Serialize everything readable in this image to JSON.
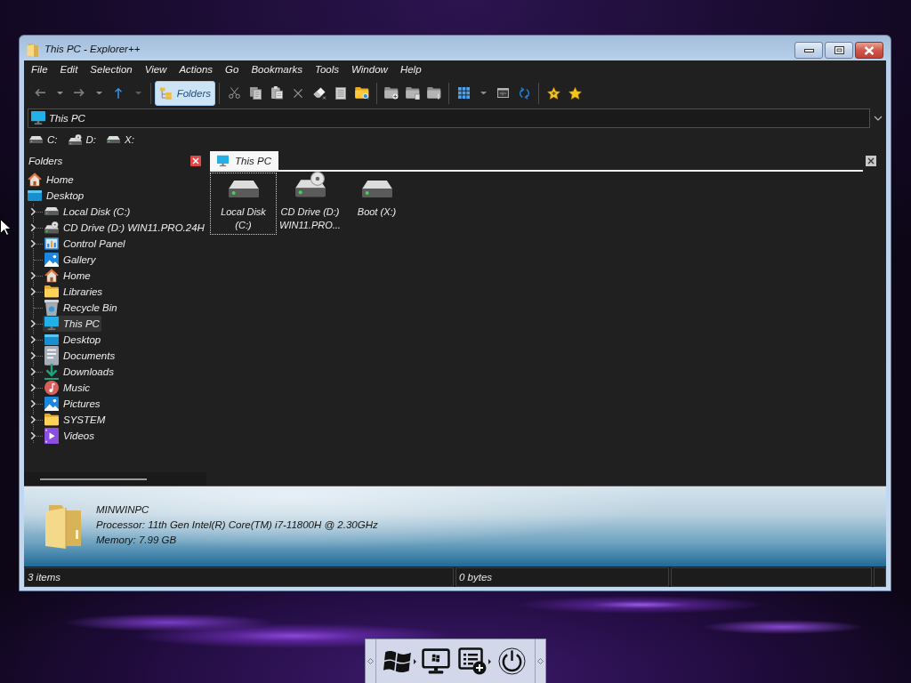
{
  "window": {
    "title": "This PC - Explorer++"
  },
  "menu": [
    "File",
    "Edit",
    "Selection",
    "View",
    "Actions",
    "Go",
    "Bookmarks",
    "Tools",
    "Window",
    "Help"
  ],
  "toolbar": [
    {
      "kind": "back",
      "disabled": true
    },
    {
      "kind": "dropdown",
      "disabled": false
    },
    {
      "kind": "forward",
      "disabled": true
    },
    {
      "kind": "dropdown",
      "disabled": false
    },
    {
      "kind": "up",
      "disabled": false
    },
    {
      "kind": "dropdown",
      "disabled": true
    },
    {
      "kind": "separator"
    },
    {
      "kind": "toggle",
      "label": "Folders",
      "selected": true
    },
    {
      "kind": "separator"
    },
    {
      "kind": "cut",
      "disabled": false
    },
    {
      "kind": "copy",
      "disabled": false
    },
    {
      "kind": "paste",
      "disabled": false
    },
    {
      "kind": "delete",
      "disabled": false
    },
    {
      "kind": "erase",
      "disabled": false
    },
    {
      "kind": "properties",
      "disabled": false
    },
    {
      "kind": "search",
      "disabled": false
    },
    {
      "kind": "separator"
    },
    {
      "kind": "newfolder",
      "disabled": false
    },
    {
      "kind": "copyto",
      "disabled": false
    },
    {
      "kind": "moveto",
      "disabled": false
    },
    {
      "kind": "separator"
    },
    {
      "kind": "views",
      "disabled": false
    },
    {
      "kind": "dropdown",
      "disabled": false
    },
    {
      "kind": "console",
      "disabled": false
    },
    {
      "kind": "refresh",
      "disabled": false
    },
    {
      "kind": "separator"
    },
    {
      "kind": "addbookmark",
      "disabled": false
    },
    {
      "kind": "bookmarks",
      "disabled": false
    }
  ],
  "address_bar": {
    "value": "This PC"
  },
  "drives": [
    {
      "label": "C:",
      "kind": "disk"
    },
    {
      "label": "D:",
      "kind": "cd"
    },
    {
      "label": "X:",
      "kind": "disk"
    }
  ],
  "folders_pane": {
    "title": "Folders",
    "tree": [
      {
        "label": "Home",
        "kind": "home",
        "expander": false,
        "selected": false
      },
      {
        "label": "Desktop",
        "kind": "desktop",
        "expander": false,
        "selected": false,
        "children": [
          {
            "label": "Local Disk (C:)",
            "kind": "disk",
            "expander": true,
            "selected": false
          },
          {
            "label": "CD Drive (D:) WIN11.PRO.24H",
            "kind": "cd",
            "expander": true,
            "selected": false
          },
          {
            "label": "Control Panel",
            "kind": "panel",
            "expander": true,
            "selected": false
          },
          {
            "label": "Gallery",
            "kind": "gallery",
            "expander": false,
            "selected": false
          },
          {
            "label": "Home",
            "kind": "home",
            "expander": true,
            "selected": false
          },
          {
            "label": "Libraries",
            "kind": "library",
            "expander": true,
            "selected": false
          },
          {
            "label": "Recycle Bin",
            "kind": "bin",
            "expander": false,
            "selected": false
          },
          {
            "label": "This PC",
            "kind": "pc",
            "expander": true,
            "selected": true
          },
          {
            "label": "Desktop",
            "kind": "desktop",
            "expander": true,
            "selected": false
          },
          {
            "label": "Documents",
            "kind": "documents",
            "expander": true,
            "selected": false
          },
          {
            "label": "Downloads",
            "kind": "downloads",
            "expander": true,
            "selected": false
          },
          {
            "label": "Music",
            "kind": "music",
            "expander": true,
            "selected": false
          },
          {
            "label": "Pictures",
            "kind": "pictures",
            "expander": true,
            "selected": false
          },
          {
            "label": "SYSTEM",
            "kind": "folder",
            "expander": true,
            "selected": false
          },
          {
            "label": "Videos",
            "kind": "videos",
            "expander": true,
            "selected": false
          }
        ]
      }
    ]
  },
  "tabs": [
    {
      "label": "This PC",
      "selected": true
    }
  ],
  "files": [
    {
      "label": "Local Disk (C:)",
      "kind": "disk",
      "focused": true
    },
    {
      "label": "CD Drive (D:) WIN11.PRO...",
      "kind": "cd",
      "focused": false
    },
    {
      "label": "Boot (X:)",
      "kind": "disk",
      "focused": false
    }
  ],
  "info_pane": {
    "lines": [
      "MINWINPC",
      "Processor: 11th Gen Intel(R) Core(TM) i7-11800H @ 2.30GHz",
      "Memory: 7.99 GB"
    ]
  },
  "status_bar": [
    "3 items",
    "0 bytes"
  ]
}
